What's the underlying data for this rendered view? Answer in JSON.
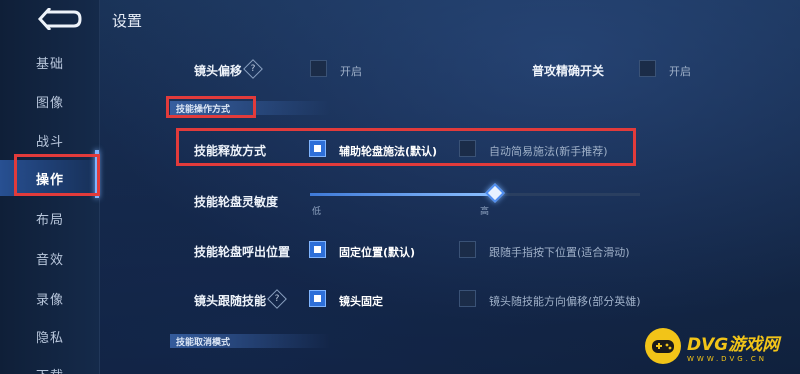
{
  "header": {
    "title": "设置"
  },
  "sidebar": {
    "items": [
      {
        "label": "基础"
      },
      {
        "label": "图像"
      },
      {
        "label": "战斗"
      },
      {
        "label": "操作"
      },
      {
        "label": "布局"
      },
      {
        "label": "音效"
      },
      {
        "label": "录像"
      },
      {
        "label": "隐私"
      },
      {
        "label": "下载"
      }
    ],
    "active": "操作"
  },
  "top_row": {
    "camera_offset": {
      "label": "镜头偏移",
      "help": "?",
      "option": "开启",
      "checked": false
    },
    "precise_attack": {
      "label": "普攻精确开关",
      "option": "开启",
      "checked": false
    }
  },
  "section_skill_cast": {
    "title": "技能操作方式"
  },
  "skill_cast_mode": {
    "label": "技能释放方式",
    "options": [
      {
        "text": "辅助轮盘施法(默认)",
        "checked": true
      },
      {
        "text": "自动简易施法(新手推荐)",
        "checked": false
      }
    ]
  },
  "wheel_sensitivity": {
    "label": "技能轮盘灵敏度",
    "min_label": "低",
    "max_label": "高",
    "value": 0.56
  },
  "wheel_position": {
    "label": "技能轮盘呼出位置",
    "options": [
      {
        "text": "固定位置(默认)",
        "checked": true
      },
      {
        "text": "跟随手指按下位置(适合滑动)",
        "checked": false
      }
    ]
  },
  "camera_follow": {
    "label": "镜头跟随技能",
    "help": "?",
    "options": [
      {
        "text": "镜头固定",
        "checked": true
      },
      {
        "text": "镜头随技能方向偏移(部分英雄)",
        "checked": false
      }
    ]
  },
  "section_skill_cancel": {
    "title": "技能取消模式"
  },
  "watermark": {
    "title": "DVG游戏网",
    "sub": "WWW.DVG.CN"
  },
  "colors": {
    "accent": "#2e6fd8",
    "highlight_box": "#e23b3b",
    "logo": "#f2c418"
  }
}
